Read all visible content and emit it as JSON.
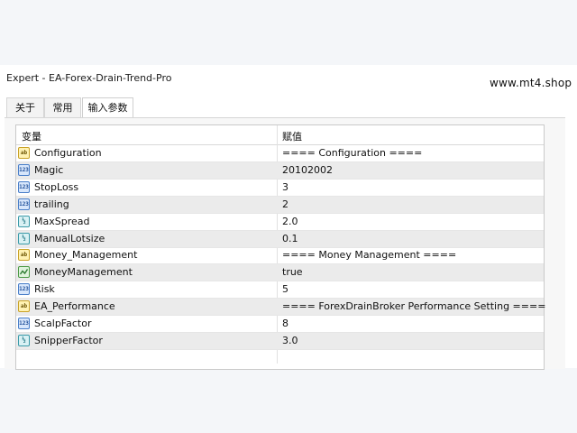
{
  "window": {
    "title": "Expert - EA-Forex-Drain-Trend-Pro",
    "watermark": "www.mt4.shop"
  },
  "tabs": [
    {
      "label": "关于",
      "active": false
    },
    {
      "label": "常用",
      "active": false
    },
    {
      "label": "输入参数",
      "active": true
    }
  ],
  "table": {
    "headers": [
      "变量",
      "赋值"
    ],
    "rows": [
      {
        "icon": "ab",
        "name": "Configuration",
        "value": "==== Configuration ===="
      },
      {
        "icon": "123",
        "name": "Magic",
        "value": "20102002"
      },
      {
        "icon": "123",
        "name": "StopLoss",
        "value": "3"
      },
      {
        "icon": "123",
        "name": "trailing",
        "value": "2"
      },
      {
        "icon": "v2",
        "name": "MaxSpread",
        "value": "2.0"
      },
      {
        "icon": "v2",
        "name": "ManualLotsize",
        "value": "0.1"
      },
      {
        "icon": "ab",
        "name": "Money_Management",
        "value": "==== Money Management ===="
      },
      {
        "icon": "bool",
        "name": "MoneyManagement",
        "value": "true"
      },
      {
        "icon": "123",
        "name": "Risk",
        "value": "5"
      },
      {
        "icon": "ab",
        "name": "EA_Performance",
        "value": "==== ForexDrainBroker Performance Setting ===="
      },
      {
        "icon": "123",
        "name": "ScalpFactor",
        "value": "8"
      },
      {
        "icon": "v2",
        "name": "SnipperFactor",
        "value": "3.0"
      }
    ]
  }
}
